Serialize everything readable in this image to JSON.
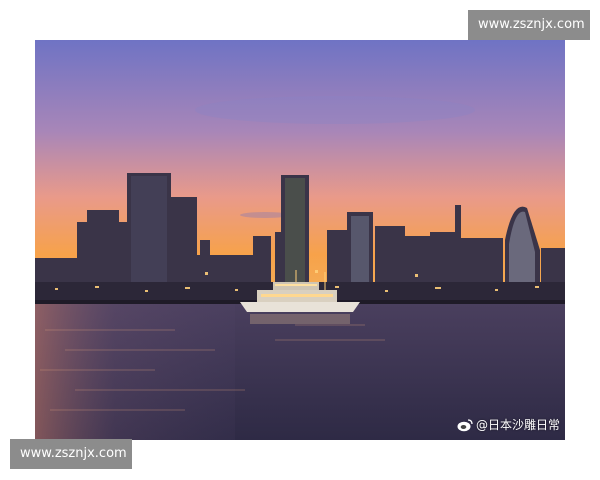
{
  "watermark": {
    "top_text": "www.zsznjx.com",
    "bottom_text": "www.zsznjx.com"
  },
  "photo": {
    "credit": "@日本沙雕日常",
    "credit_icon": "weibo-icon"
  },
  "colors": {
    "sky_top": "#6e78c8",
    "sky_mid": "#c98aa8",
    "sky_horizon": "#f6a04a",
    "water": "#3d3756",
    "watermark_bg": "#8c8c8c"
  }
}
